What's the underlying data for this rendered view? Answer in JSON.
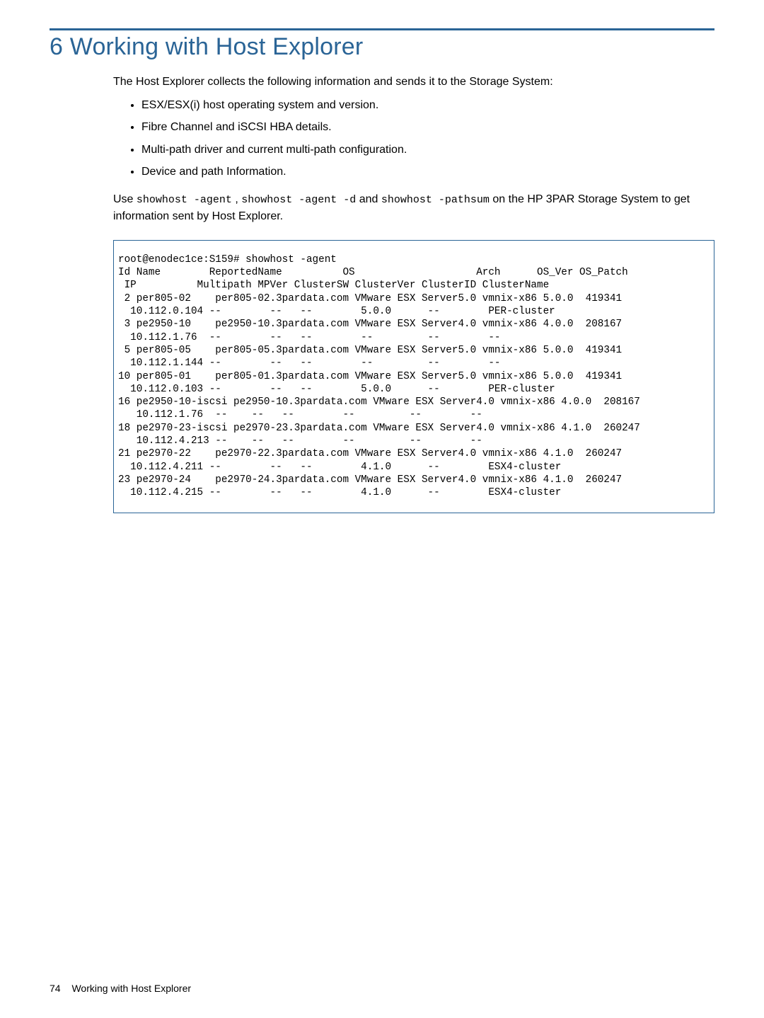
{
  "chapter_number": "6",
  "chapter_title": "Working with Host Explorer",
  "intro": "The Host Explorer collects the following information and sends it to the Storage System:",
  "bullets": [
    "ESX/ESX(i) host operating system and version.",
    "Fibre Channel and iSCSI HBA details.",
    "Multi-path driver and current multi-path configuration.",
    "Device and path Information."
  ],
  "use_sentence_parts": {
    "lead": "Use ",
    "cmd1": "showhost -agent",
    "sep1": " , ",
    "cmd2": "showhost -agent -d",
    "and": " and ",
    "cmd3": "showhost -pathsum",
    "tail": " on the HP 3PAR Storage System to get information sent by Host Explorer."
  },
  "code_lines": [
    "root@enodec1ce:S159# showhost -agent",
    "Id Name        ReportedName          OS                    Arch      OS_Ver OS_Patch",
    " IP          Multipath MPVer ClusterSW ClusterVer ClusterID ClusterName",
    " 2 per805-02    per805-02.3pardata.com VMware ESX Server5.0 vmnix-x86 5.0.0  419341",
    "  10.112.0.104 --        --   --        5.0.0      --        PER-cluster",
    " 3 pe2950-10    pe2950-10.3pardata.com VMware ESX Server4.0 vmnix-x86 4.0.0  208167",
    "  10.112.1.76  --        --   --        --         --        --",
    " 5 per805-05    per805-05.3pardata.com VMware ESX Server5.0 vmnix-x86 5.0.0  419341",
    "  10.112.1.144 --        --   --        --         --        --",
    "10 per805-01    per805-01.3pardata.com VMware ESX Server5.0 vmnix-x86 5.0.0  419341",
    "  10.112.0.103 --        --   --        5.0.0      --        PER-cluster",
    "16 pe2950-10-iscsi pe2950-10.3pardata.com VMware ESX Server4.0 vmnix-x86 4.0.0  208167",
    "   10.112.1.76  --    --   --        --         --        --",
    "18 pe2970-23-iscsi pe2970-23.3pardata.com VMware ESX Server4.0 vmnix-x86 4.1.0  260247",
    "   10.112.4.213 --    --   --        --         --        --",
    "21 pe2970-22    pe2970-22.3pardata.com VMware ESX Server4.0 vmnix-x86 4.1.0  260247",
    "  10.112.4.211 --        --   --        4.1.0      --        ESX4-cluster",
    "23 pe2970-24    pe2970-24.3pardata.com VMware ESX Server4.0 vmnix-x86 4.1.0  260247",
    "  10.112.4.215 --        --   --        4.1.0      --        ESX4-cluster"
  ],
  "footer": {
    "page_number": "74",
    "title": "Working with Host Explorer"
  }
}
